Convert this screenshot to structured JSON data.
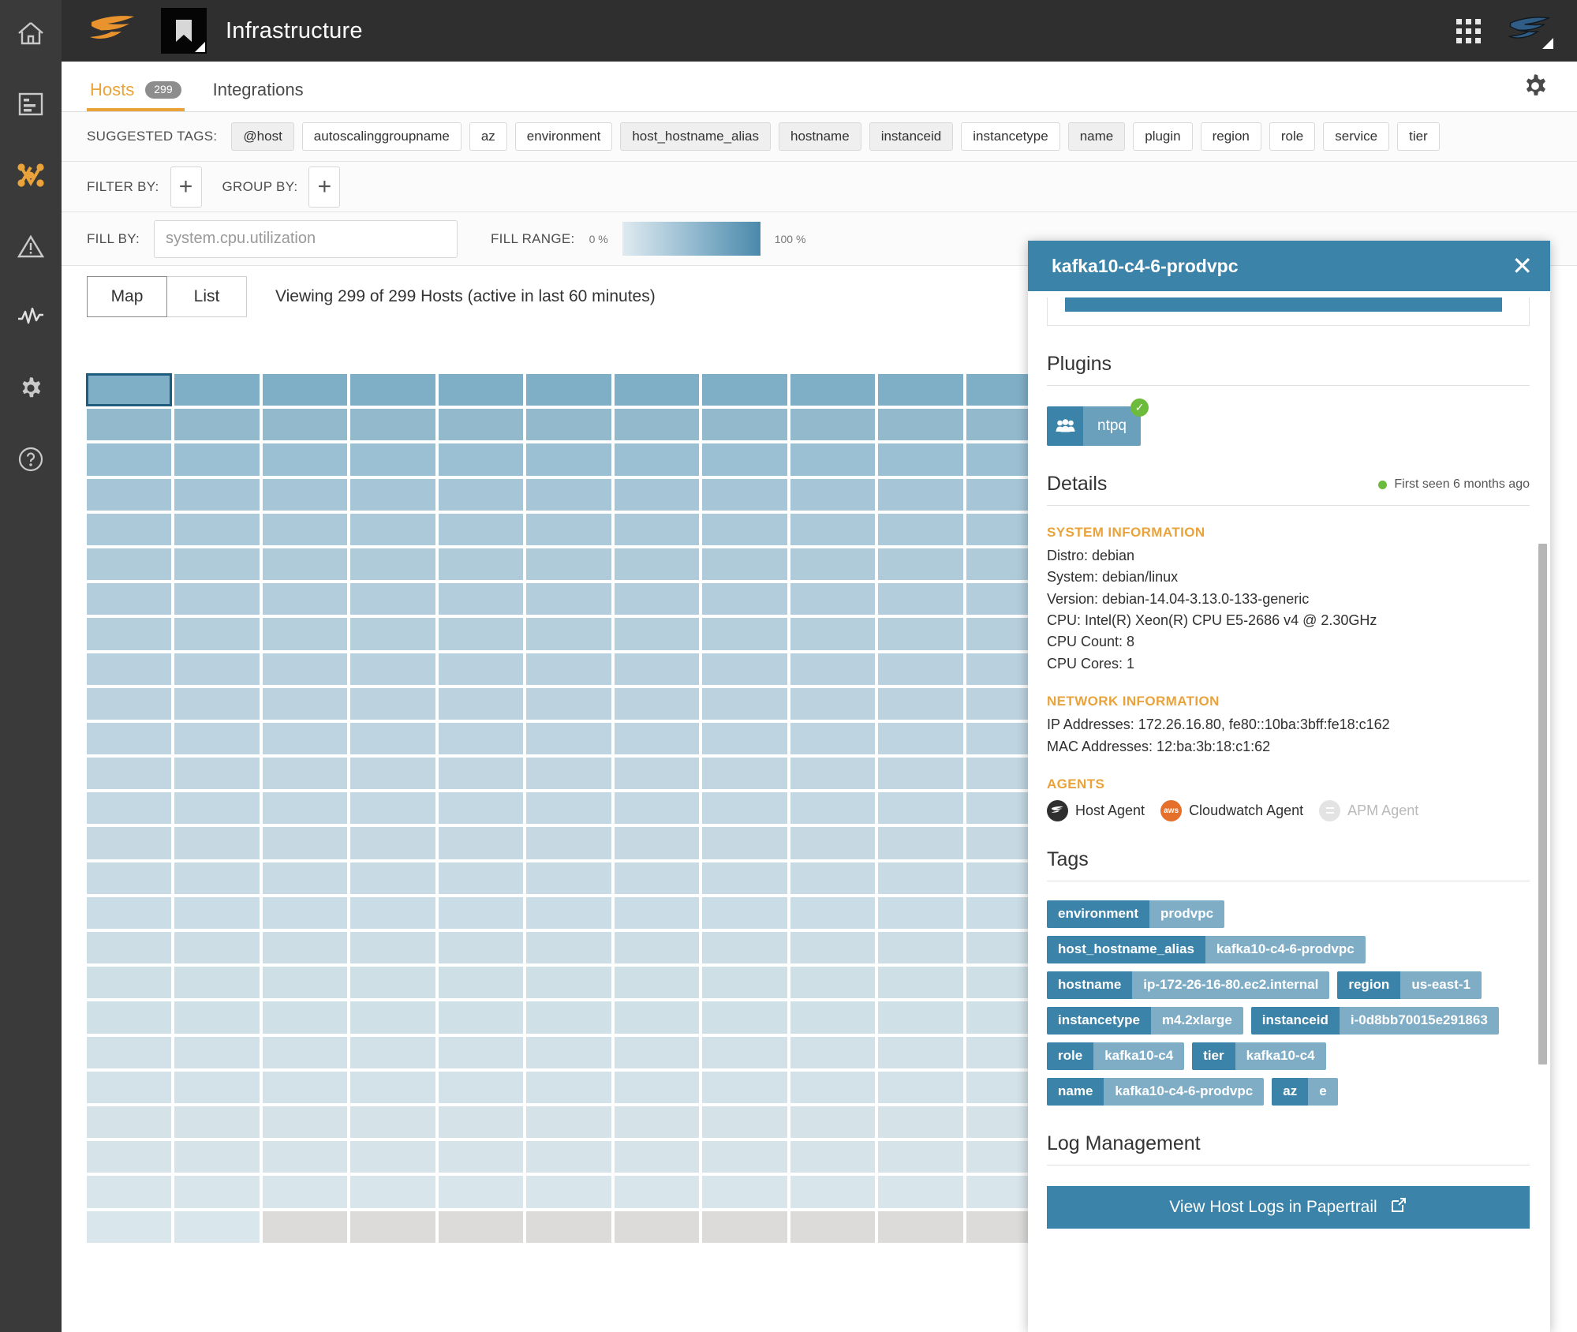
{
  "rail": {
    "items": [
      {
        "name": "home-icon",
        "active": false
      },
      {
        "name": "list-icon",
        "active": false
      },
      {
        "name": "topology-icon",
        "active": true
      },
      {
        "name": "alert-icon",
        "active": false
      },
      {
        "name": "activity-icon",
        "active": false
      },
      {
        "name": "settings-icon",
        "active": false
      },
      {
        "name": "help-icon",
        "active": false
      }
    ]
  },
  "topbar": {
    "title": "Infrastructure",
    "brand_icon": "solarwinds-logo",
    "app_badge_icon": "bookmark-icon",
    "apps_grid_icon": "apps-grid-icon",
    "account_icon": "account-avatar-icon"
  },
  "tabs": {
    "items": [
      {
        "label": "Hosts",
        "count": "299",
        "active": true
      },
      {
        "label": "Integrations",
        "count": "",
        "active": false
      }
    ],
    "settings_icon": "gear-icon"
  },
  "suggested": {
    "label": "SUGGESTED TAGS:",
    "tags": [
      {
        "label": "@host",
        "style": "filled"
      },
      {
        "label": "autoscalinggroupname",
        "style": "plain"
      },
      {
        "label": "az",
        "style": "plain"
      },
      {
        "label": "environment",
        "style": "plain"
      },
      {
        "label": "host_hostname_alias",
        "style": "filled"
      },
      {
        "label": "hostname",
        "style": "filled"
      },
      {
        "label": "instanceid",
        "style": "filled"
      },
      {
        "label": "instancetype",
        "style": "plain"
      },
      {
        "label": "name",
        "style": "filled"
      },
      {
        "label": "plugin",
        "style": "plain"
      },
      {
        "label": "region",
        "style": "plain"
      },
      {
        "label": "role",
        "style": "plain"
      },
      {
        "label": "service",
        "style": "plain"
      },
      {
        "label": "tier",
        "style": "plain"
      }
    ]
  },
  "filter_row": {
    "filter_label": "FILTER BY:",
    "group_label": "GROUP BY:",
    "add_symbol": "+"
  },
  "fill_row": {
    "fill_label": "FILL BY:",
    "fill_placeholder": "system.cpu.utilization",
    "fill_value": "",
    "range_label": "FILL RANGE:",
    "range_min": "0 %",
    "range_max": "100 %"
  },
  "view_row": {
    "map_label": "Map",
    "list_label": "List",
    "selected": "Map",
    "viewing_text": "Viewing 299 of 299 Hosts (active in last 60 minutes)"
  },
  "host_map": {
    "columns": 11,
    "rows": 25,
    "total_hosts": 299,
    "selected_index": 0,
    "inactive_count": 9,
    "colors": {
      "row_shades": [
        "#7fafc7",
        "#93b9cd",
        "#9cc0d3",
        "#a6c6d7",
        "#abc9d9",
        "#afcbda",
        "#b3cddc",
        "#b6cfdd",
        "#b9d1de",
        "#bcd3df",
        "#bed4e0",
        "#c1d6e1",
        "#c3d8e2",
        "#c6d9e3",
        "#c8dbe4",
        "#cadce5",
        "#ccdde5",
        "#cedfe6",
        "#d0e0e7",
        "#d2e1e8",
        "#d3e2e8",
        "#d5e3e9",
        "#d6e4ea",
        "#d8e5ea",
        "#d9e6eb"
      ],
      "inactive": "#dcdbda",
      "selected_outline": "#1f5c7e"
    }
  },
  "panel": {
    "title": "kafka10-c4-6-prodvpc",
    "close_icon": "close-icon",
    "plugins": {
      "heading": "Plugins",
      "items": [
        {
          "name": "ntpq",
          "icon": "users-icon",
          "status": "ok"
        }
      ]
    },
    "details": {
      "heading": "Details",
      "first_seen": "First seen 6 months ago",
      "system_information": {
        "heading": "SYSTEM INFORMATION",
        "lines": [
          "Distro: debian",
          "System: debian/linux",
          "Version: debian-14.04-3.13.0-133-generic",
          "CPU: Intel(R) Xeon(R) CPU E5-2686 v4 @ 2.30GHz",
          "CPU Count: 8",
          "CPU Cores: 1"
        ]
      },
      "network_information": {
        "heading": "NETWORK INFORMATION",
        "lines": [
          "IP Addresses: 172.26.16.80, fe80::10ba:3bff:fe18:c162",
          "MAC Addresses: 12:ba:3b:18:c1:62"
        ]
      },
      "agents": {
        "heading": "AGENTS",
        "items": [
          {
            "label": "Host Agent",
            "icon": "solarwinds-agent-icon",
            "enabled": true
          },
          {
            "label": "Cloudwatch Agent",
            "icon": "aws-icon",
            "enabled": true
          },
          {
            "label": "APM Agent",
            "icon": "apm-icon",
            "enabled": false
          }
        ]
      }
    },
    "tags": {
      "heading": "Tags",
      "items": [
        {
          "key": "environment",
          "value": "prodvpc"
        },
        {
          "key": "host_hostname_alias",
          "value": "kafka10-c4-6-prodvpc"
        },
        {
          "key": "hostname",
          "value": "ip-172-26-16-80.ec2.internal"
        },
        {
          "key": "region",
          "value": "us-east-1"
        },
        {
          "key": "instancetype",
          "value": "m4.2xlarge"
        },
        {
          "key": "instanceid",
          "value": "i-0d8bb70015e291863"
        },
        {
          "key": "role",
          "value": "kafka10-c4"
        },
        {
          "key": "tier",
          "value": "kafka10-c4"
        },
        {
          "key": "name",
          "value": "kafka10-c4-6-prodvpc"
        },
        {
          "key": "az",
          "value": "e"
        }
      ]
    },
    "log_management": {
      "heading": "Log Management",
      "button_label": "View Host Logs in Papertrail",
      "button_icon": "external-link-icon"
    }
  },
  "colors": {
    "accent_orange": "#e9a33a",
    "panel_blue": "#3b83a8",
    "tag_value_blue": "#7fadc6",
    "rail_bg": "#3a3a3a",
    "topbar_bg": "#2f2f2f",
    "status_green": "#6cbb3c"
  }
}
